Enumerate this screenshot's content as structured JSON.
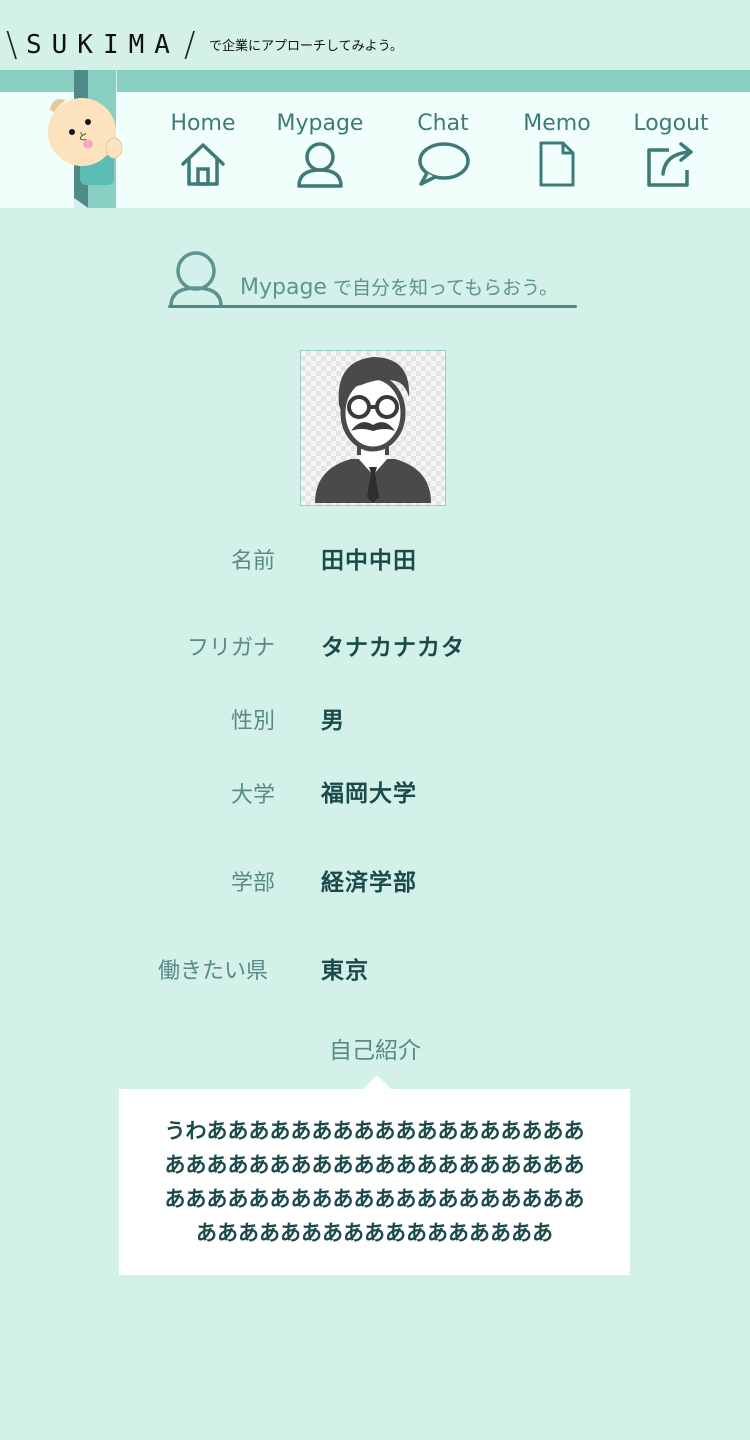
{
  "brand": {
    "slash_left": "\\",
    "logo": "SUKIMA",
    "slash_right": "/",
    "tagline": "で企業にアプローチしてみよう。"
  },
  "nav": {
    "items": [
      {
        "label": "Home",
        "icon": "home-icon"
      },
      {
        "label": "Mypage",
        "icon": "user-icon"
      },
      {
        "label": "Chat",
        "icon": "chat-bubble-icon"
      },
      {
        "label": "Memo",
        "icon": "document-icon"
      },
      {
        "label": "Logout",
        "icon": "logout-icon"
      }
    ]
  },
  "section": {
    "title": "Mypage",
    "subtitle": " で自分を知ってもらおう。"
  },
  "profile": {
    "fields": [
      {
        "label": "名前",
        "value": "田中中田"
      },
      {
        "label": "フリガナ",
        "value": "タナカナカタ"
      },
      {
        "label": "性別",
        "value": "男"
      },
      {
        "label": "大学",
        "value": "福岡大学"
      },
      {
        "label": "学部",
        "value": "経済学部"
      },
      {
        "label": "働きたい県",
        "value": "東京"
      }
    ],
    "intro_label": "自己紹介",
    "intro_text": "うわあああああああああああああああああああああああああああああああああああああああああああああああああああああああああああああああああああああああああああ"
  },
  "colors": {
    "background": "#d3f1e9",
    "nav_background": "#f0fffc",
    "accent_stripe": "#88cfc2",
    "icon_stroke": "#3e7a78"
  }
}
